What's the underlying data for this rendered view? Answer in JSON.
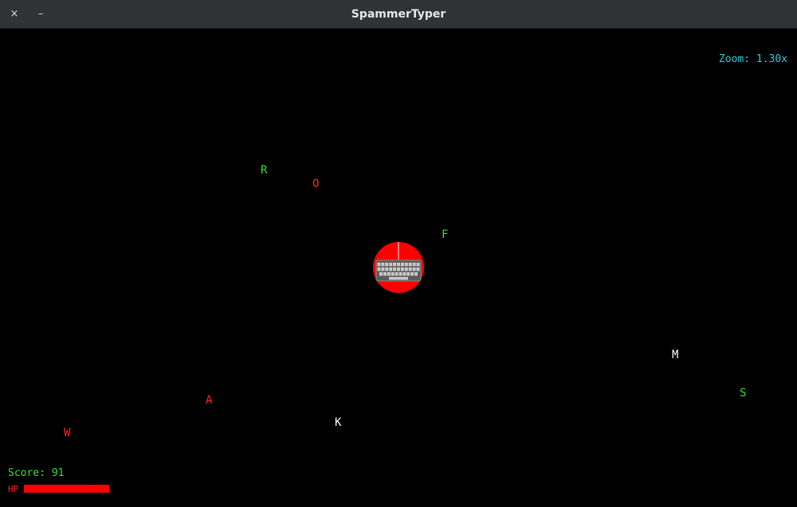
{
  "window": {
    "title": "SpammerTyper",
    "close_glyph": "×",
    "minimize_glyph": "–"
  },
  "hud": {
    "zoom": "Zoom: 1.30x",
    "score": "Score: 91",
    "hp_label": "HP",
    "hp_fraction": 1.0
  },
  "letters": [
    {
      "char": "R",
      "color": "green"
    },
    {
      "char": "O",
      "color": "red"
    },
    {
      "char": "F",
      "color": "green"
    },
    {
      "char": "M",
      "color": "white"
    },
    {
      "char": "S",
      "color": "green"
    },
    {
      "char": "A",
      "color": "red"
    },
    {
      "char": "K",
      "color": "white"
    },
    {
      "char": "W",
      "color": "red"
    }
  ],
  "colors": {
    "green": "#33e033",
    "red": "#ff2222",
    "white": "#ffffff",
    "zoom": "#33c9d6",
    "player": "#ff0000",
    "hp": "#ff0000"
  },
  "player": {
    "icon": "keyboard-icon"
  }
}
